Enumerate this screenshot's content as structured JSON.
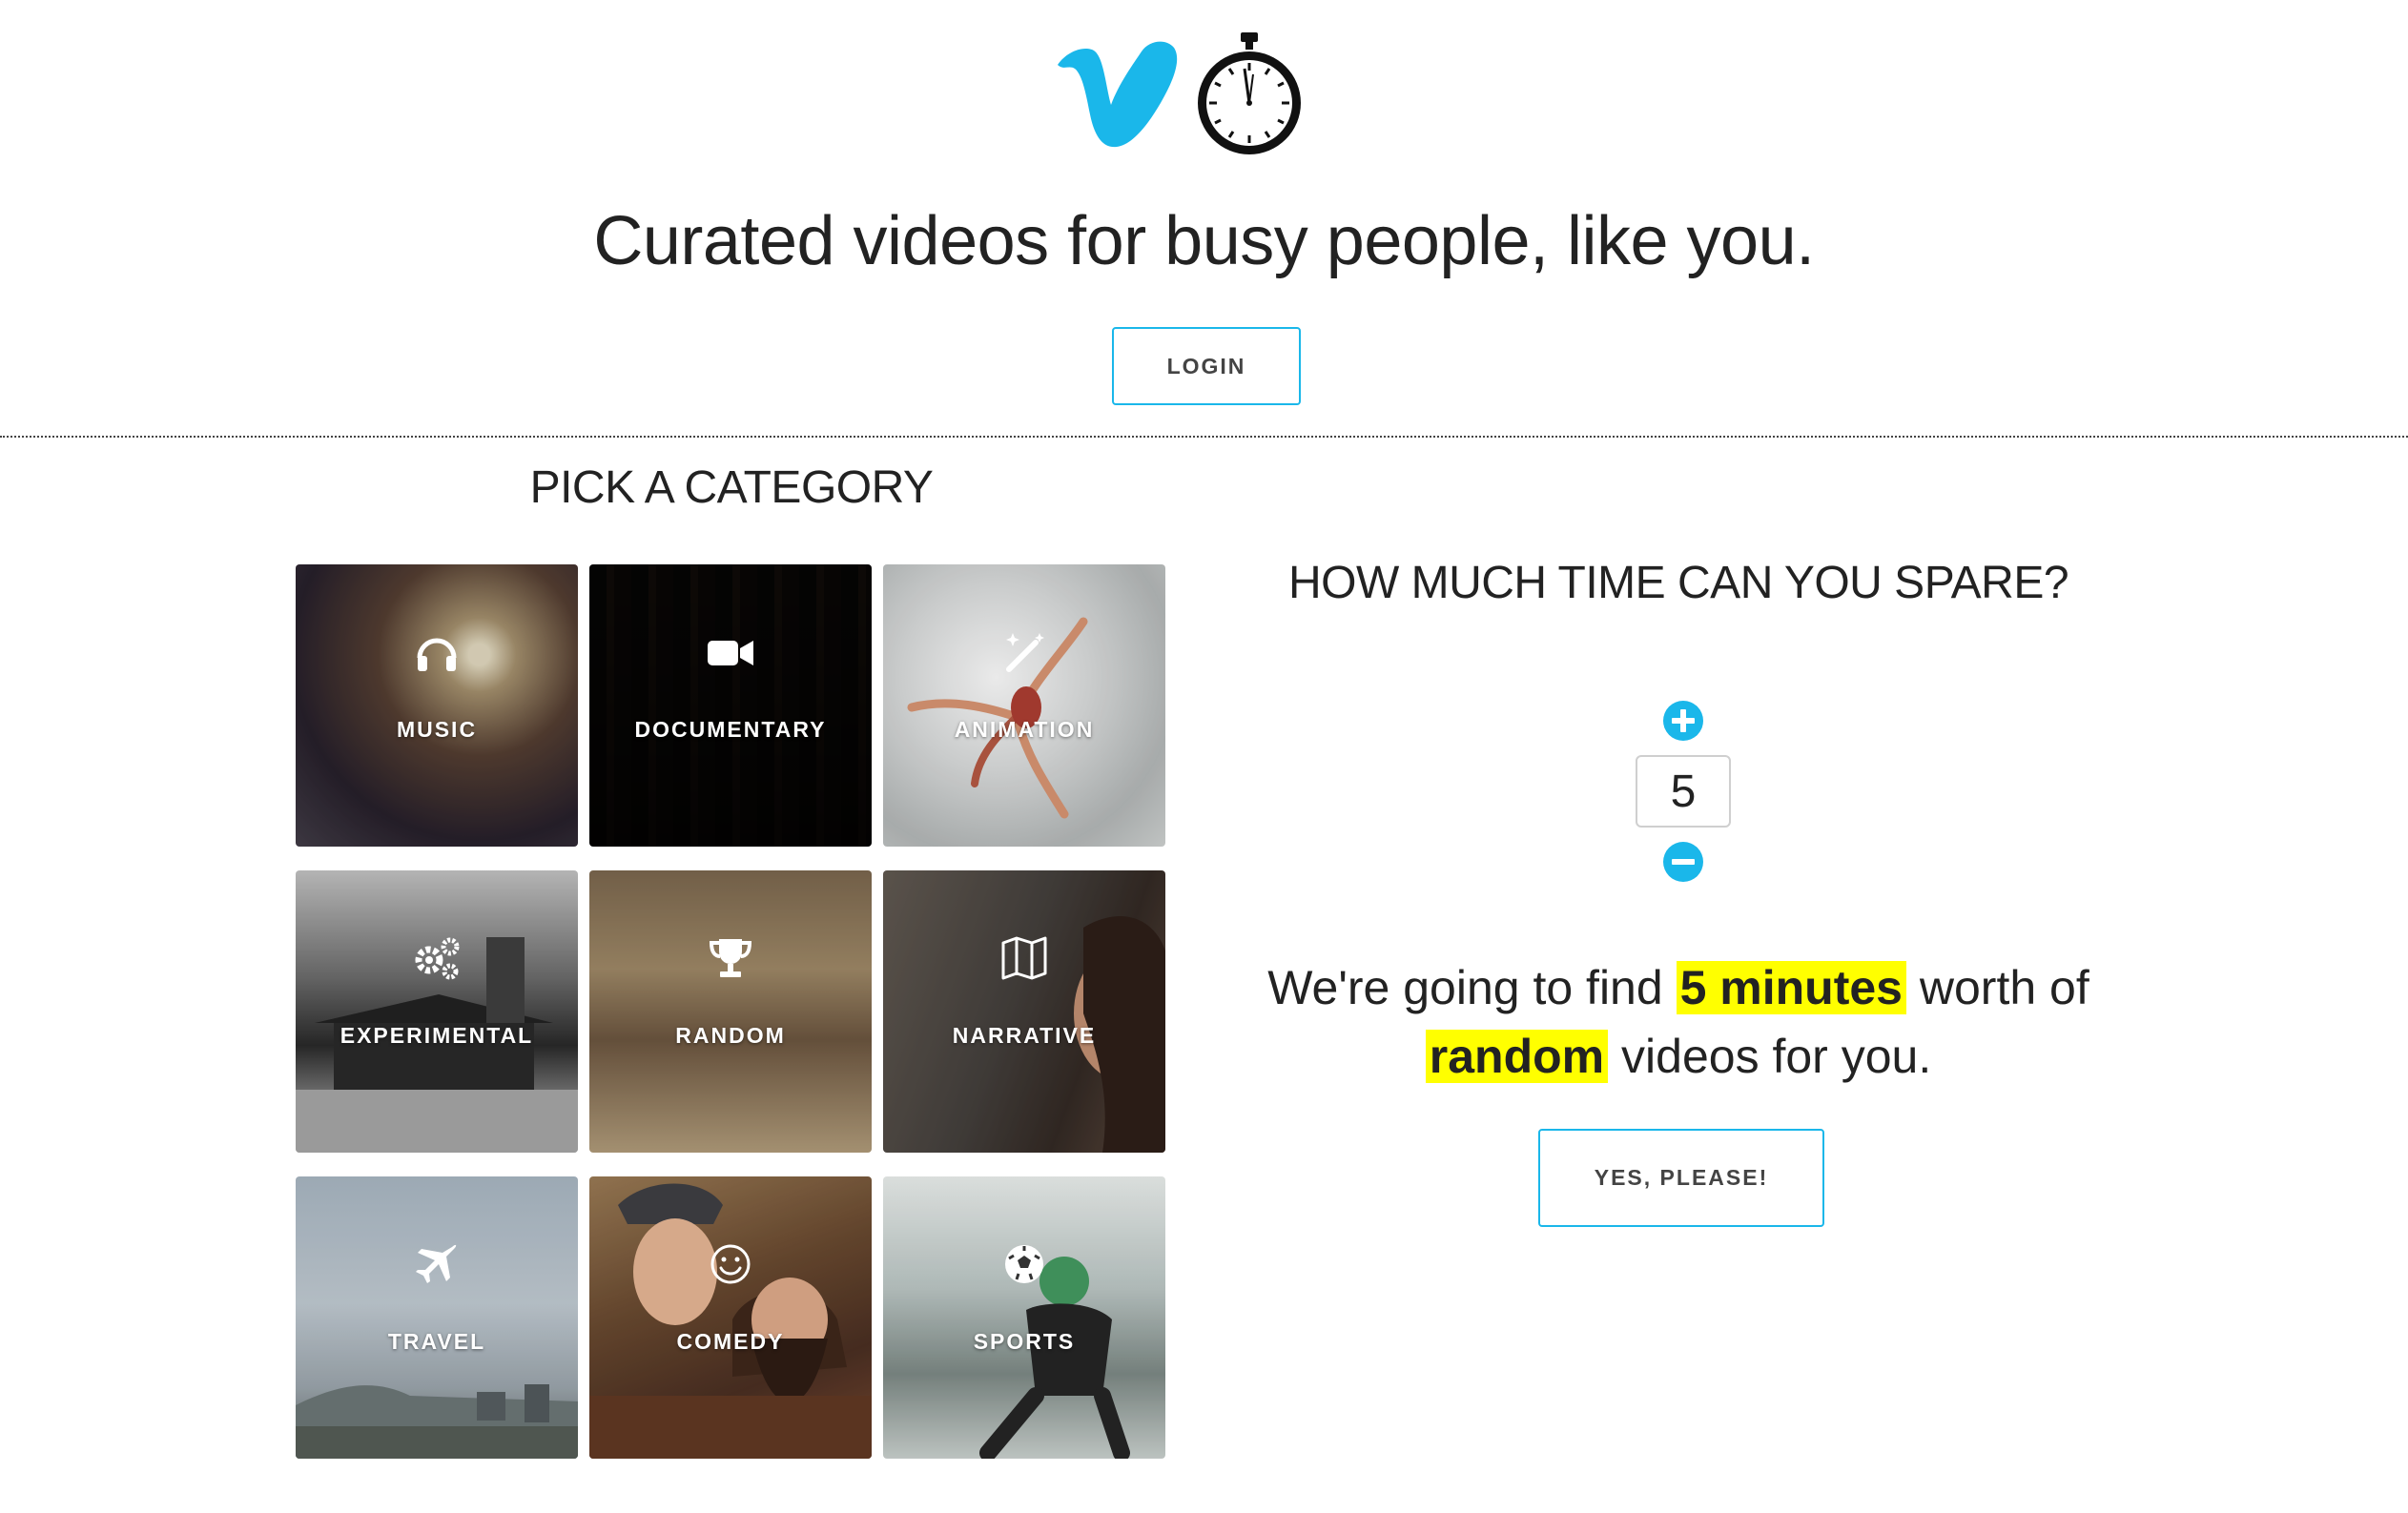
{
  "header": {
    "logo_icon": "vimeo-v-stopwatch-logo",
    "tagline": "Curated videos for busy people, like you.",
    "login_label": "LOGIN"
  },
  "categories": {
    "title": "PICK A CATEGORY",
    "items": [
      {
        "label": "MUSIC",
        "icon": "headphones-icon"
      },
      {
        "label": "DOCUMENTARY",
        "icon": "video-camera-icon"
      },
      {
        "label": "ANIMATION",
        "icon": "magic-wand-icon"
      },
      {
        "label": "EXPERIMENTAL",
        "icon": "gears-icon"
      },
      {
        "label": "RANDOM",
        "icon": "trophy-icon"
      },
      {
        "label": "NARRATIVE",
        "icon": "map-icon"
      },
      {
        "label": "TRAVEL",
        "icon": "airplane-icon"
      },
      {
        "label": "COMEDY",
        "icon": "smiley-icon"
      },
      {
        "label": "SPORTS",
        "icon": "soccer-ball-icon"
      }
    ]
  },
  "time": {
    "question": "HOW MUCH TIME CAN YOU SPARE?",
    "value": "5",
    "summary_prefix": "We're going to find",
    "summary_minutes": "5 minutes",
    "summary_mid": "worth of",
    "summary_category": "random",
    "summary_suffix": "videos for you.",
    "confirm_label": "YES, PLEASE!"
  },
  "colors": {
    "accent": "#1ab7ea",
    "highlight": "#ffff00",
    "text": "#222222"
  }
}
